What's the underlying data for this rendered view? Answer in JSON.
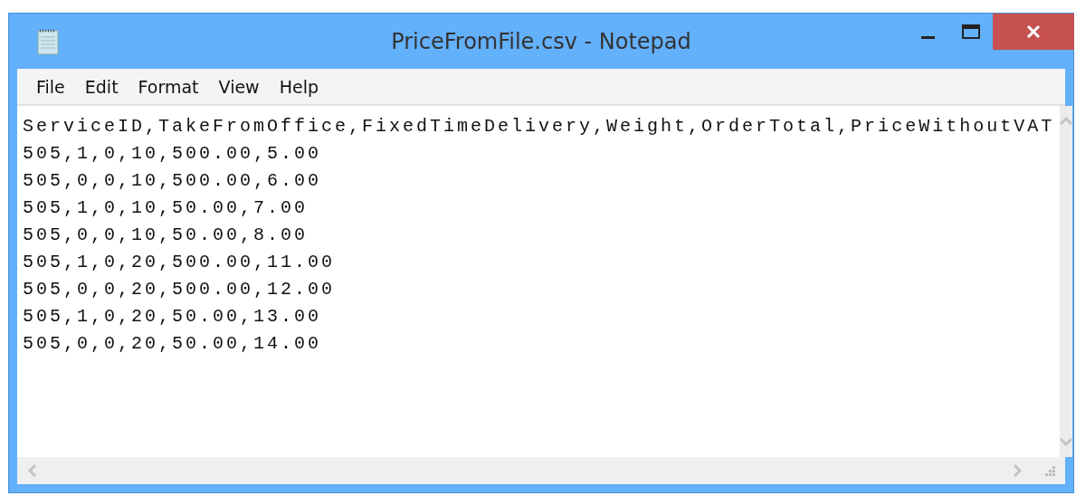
{
  "window": {
    "title": "PriceFromFile.csv - Notepad"
  },
  "menu": [
    {
      "label": "File"
    },
    {
      "label": "Edit"
    },
    {
      "label": "Format"
    },
    {
      "label": "View"
    },
    {
      "label": "Help"
    }
  ],
  "document": {
    "lines": [
      "ServiceID,TakeFromOffice,FixedTimeDelivery,Weight,OrderTotal,PriceWithoutVAT",
      "505,1,0,10,500.00,5.00",
      "505,0,0,10,500.00,6.00",
      "505,1,0,10,50.00,7.00",
      "505,0,0,10,50.00,8.00",
      "505,1,0,20,500.00,11.00",
      "505,0,0,20,500.00,12.00",
      "505,1,0,20,50.00,13.00",
      "505,0,0,20,50.00,14.00"
    ]
  }
}
